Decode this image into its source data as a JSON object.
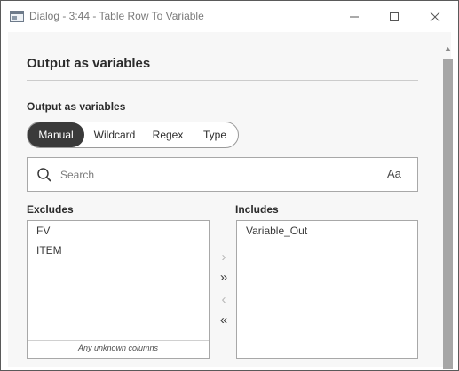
{
  "window": {
    "title": "Dialog - 3:44 - Table Row To Variable",
    "icons": [
      "app-window-icon",
      "minimize-icon",
      "maximize-icon",
      "close-icon"
    ]
  },
  "section": {
    "title": "Output as variables"
  },
  "field": {
    "label": "Output as variables"
  },
  "mode": {
    "options": [
      "Manual",
      "Wildcard",
      "Regex",
      "Type"
    ],
    "selected": "Manual"
  },
  "search": {
    "placeholder": "Search",
    "value": "",
    "case_toggle": "Aa"
  },
  "excludes": {
    "label": "Excludes",
    "items": [
      "FV",
      "ITEM"
    ],
    "footer": "Any unknown columns"
  },
  "includes": {
    "label": "Includes",
    "items": [
      "Variable_Out"
    ]
  },
  "move_buttons": {
    "right": "›",
    "all_right": "»",
    "left": "‹",
    "all_left": "«"
  },
  "colors": {
    "selected_segment": "#3a3a3a",
    "panel_background": "#f7f7f7",
    "scrollbar_thumb": "#a6a6a6"
  }
}
